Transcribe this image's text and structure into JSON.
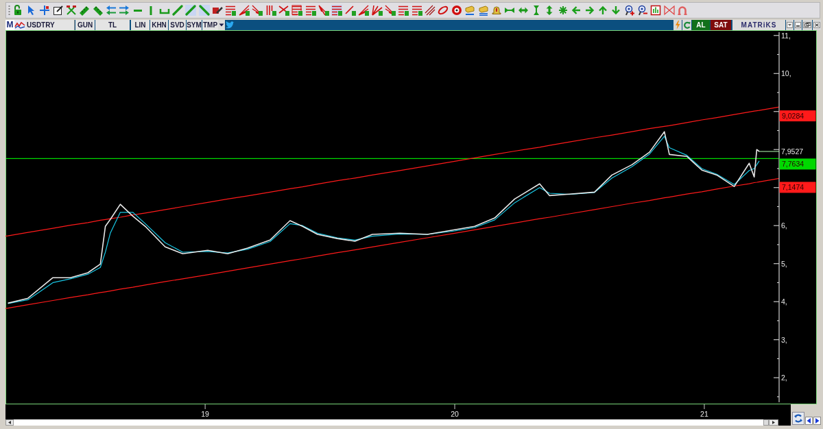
{
  "symbol_bar": {
    "logo": "M",
    "symbol": "USDTRY",
    "options": [
      "GUN",
      "TL",
      "LIN",
      "KHN",
      "SVD",
      "SYM",
      "TMP"
    ],
    "trade_buttons": [
      {
        "label": "AL",
        "kind": "buy"
      },
      {
        "label": "SAT",
        "kind": "sell"
      }
    ],
    "brand": "MATRiKS"
  },
  "chart": {
    "chart_data": {
      "type": "line",
      "x": [
        2018.2,
        2018.21,
        2018.29,
        2018.39,
        2018.46,
        2018.53,
        2018.58,
        2018.6,
        2018.62,
        2018.66,
        2018.71,
        2018.76,
        2018.84,
        2018.91,
        2019.01,
        2019.09,
        2019.17,
        2019.26,
        2019.34,
        2019.39,
        2019.45,
        2019.53,
        2019.6,
        2019.67,
        2019.78,
        2019.89,
        2020.0,
        2020.08,
        2020.16,
        2020.24,
        2020.34,
        2020.38,
        2020.46,
        2020.56,
        2020.63,
        2020.71,
        2020.78,
        2020.84,
        2020.86,
        2020.93,
        2020.99,
        2021.05,
        2021.12,
        2021.18,
        2021.2,
        2021.21,
        2021.22,
        2021.3
      ],
      "series": [
        {
          "name": "7,9527",
          "color": "#e8e8e8",
          "values": [
            null,
            3.96,
            4.09,
            4.63,
            4.63,
            4.76,
            4.99,
            5.98,
            6.16,
            6.56,
            6.25,
            5.98,
            5.44,
            5.26,
            5.35,
            5.26,
            5.41,
            5.62,
            6.13,
            5.98,
            5.77,
            5.66,
            5.59,
            5.77,
            5.8,
            5.77,
            5.89,
            5.98,
            6.2,
            6.7,
            7.1,
            6.79,
            6.83,
            6.88,
            7.33,
            7.6,
            7.93,
            8.47,
            7.87,
            7.82,
            7.46,
            7.33,
            7.03,
            7.64,
            7.28,
            8.0,
            7.95,
            null
          ]
        },
        {
          "color": "#19c8e6",
          "values": [
            null,
            3.95,
            4.05,
            4.5,
            4.6,
            4.72,
            4.9,
            5.3,
            5.8,
            6.35,
            6.35,
            6.05,
            5.55,
            5.3,
            5.32,
            5.28,
            5.38,
            5.58,
            6.05,
            6.0,
            5.8,
            5.68,
            5.62,
            5.72,
            5.78,
            5.77,
            5.86,
            5.95,
            6.15,
            6.6,
            7.0,
            6.85,
            6.82,
            6.87,
            7.25,
            7.55,
            7.88,
            8.35,
            8.05,
            7.85,
            7.5,
            7.35,
            7.08,
            7.45,
            7.5,
            7.6,
            7.7,
            null
          ]
        },
        {
          "name": "9,0284",
          "color": "#ff1a1a",
          "values": [
            5.72,
            5.73,
            5.82,
            5.93,
            6.01,
            6.08,
            6.14,
            6.16,
            6.18,
            6.22,
            6.28,
            6.33,
            6.42,
            6.5,
            6.61,
            6.7,
            6.78,
            6.88,
            6.97,
            7.02,
            7.09,
            7.18,
            7.25,
            7.33,
            7.45,
            7.57,
            7.69,
            7.78,
            7.87,
            7.96,
            8.06,
            8.11,
            8.2,
            8.31,
            8.38,
            8.47,
            8.55,
            8.61,
            8.63,
            8.71,
            8.78,
            8.84,
            8.92,
            8.99,
            9.01,
            9.02,
            9.03,
            9.12
          ]
        },
        {
          "name": "7,1474",
          "color": "#ff1a1a",
          "values": [
            3.82,
            3.83,
            3.92,
            4.03,
            4.11,
            4.18,
            4.24,
            4.26,
            4.28,
            4.33,
            4.38,
            4.44,
            4.53,
            4.6,
            4.71,
            4.8,
            4.89,
            4.99,
            5.08,
            5.13,
            5.2,
            5.29,
            5.36,
            5.44,
            5.56,
            5.68,
            5.8,
            5.89,
            5.98,
            6.07,
            6.18,
            6.22,
            6.31,
            6.42,
            6.5,
            6.59,
            6.66,
            6.73,
            6.75,
            6.83,
            6.89,
            6.96,
            7.04,
            7.1,
            7.13,
            7.14,
            7.15,
            7.24
          ]
        }
      ],
      "xlim": [
        2018.2,
        2021.45
      ],
      "ylim": [
        1.3,
        11.14
      ],
      "xticks": [
        {
          "value": 2019,
          "label": "19"
        },
        {
          "value": 2020,
          "label": "20"
        },
        {
          "value": 2021,
          "label": "21"
        }
      ],
      "yticks": [
        {
          "value": 2,
          "label": "2,"
        },
        {
          "value": 3,
          "label": "3,"
        },
        {
          "value": 4,
          "label": "4,"
        },
        {
          "value": 5,
          "label": "5,"
        },
        {
          "value": 6,
          "label": "6,"
        },
        {
          "value": 10,
          "label": "10,"
        },
        {
          "value": 11,
          "label": "11,"
        }
      ],
      "ref_lines": [
        {
          "axis": "y",
          "value": 7.7634,
          "color": "#00d800",
          "label": "7,7634"
        }
      ]
    }
  }
}
